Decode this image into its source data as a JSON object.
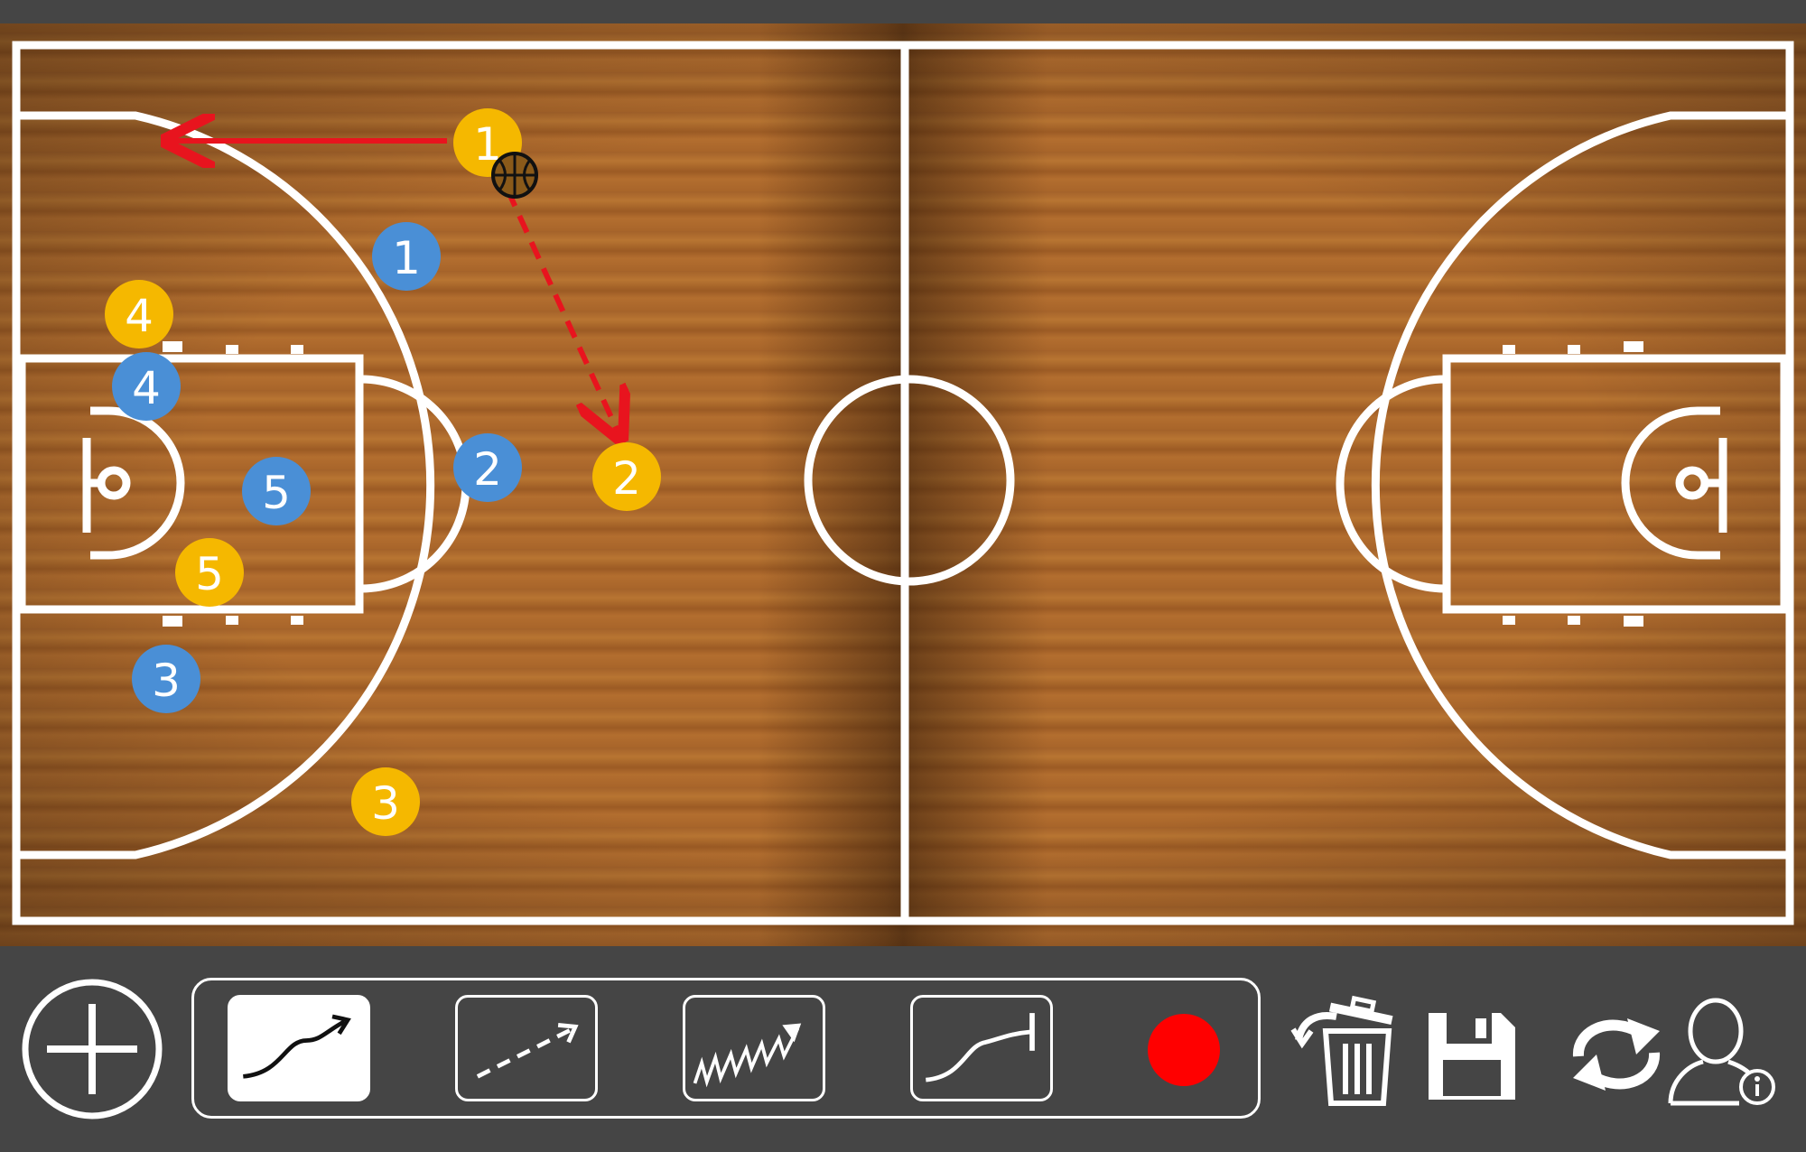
{
  "court": {
    "colors": {
      "wood": "#a8652a",
      "lines": "#ffffff",
      "offense": "#f5b800",
      "defense": "#4a8fd6",
      "pass_arrow": "#e8141e"
    }
  },
  "players": {
    "offense": [
      {
        "number": "1"
      },
      {
        "number": "2"
      },
      {
        "number": "3"
      },
      {
        "number": "4"
      },
      {
        "number": "5"
      }
    ],
    "defense": [
      {
        "number": "1"
      },
      {
        "number": "2"
      },
      {
        "number": "3"
      },
      {
        "number": "4"
      },
      {
        "number": "5"
      }
    ]
  },
  "annotations": {
    "ball": "basketball-icon",
    "arrows": [
      {
        "type": "solid",
        "color": "#e8141e",
        "meaning": "cut/move"
      },
      {
        "type": "dashed",
        "color": "#e8141e",
        "meaning": "pass"
      }
    ]
  },
  "toolbar": {
    "add_button": "plus-icon",
    "tools": [
      {
        "name": "curved-arrow-tool",
        "selected": true
      },
      {
        "name": "dashed-arrow-tool",
        "selected": false
      },
      {
        "name": "zigzag-arrow-tool",
        "selected": false
      },
      {
        "name": "screen-line-tool",
        "selected": false
      }
    ],
    "record": "record-icon",
    "actions": [
      "trash-icon",
      "save-icon",
      "refresh-icon",
      "user-info-icon"
    ]
  }
}
